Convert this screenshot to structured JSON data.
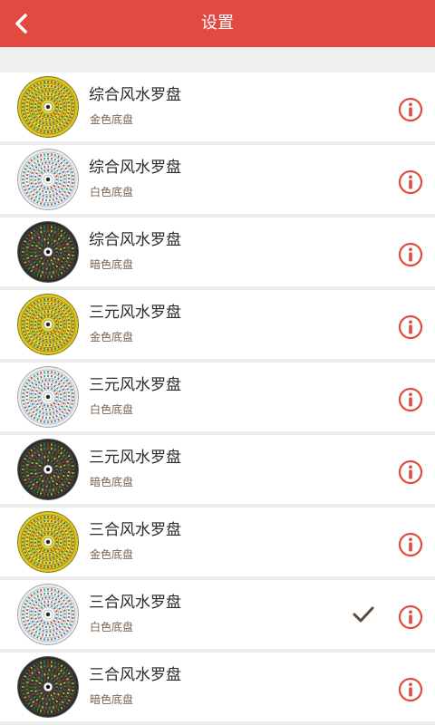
{
  "header": {
    "title": "设置",
    "back_icon": "chevron-left-icon",
    "bg_color": "#e04a40"
  },
  "items": [
    {
      "name": "综合风水罗盘",
      "sub": "金色底盘",
      "theme": "gold",
      "selected": false
    },
    {
      "name": "综合风水罗盘",
      "sub": "白色底盘",
      "theme": "white",
      "selected": false
    },
    {
      "name": "综合风水罗盘",
      "sub": "暗色底盘",
      "theme": "dark",
      "selected": false
    },
    {
      "name": "三元风水罗盘",
      "sub": "金色底盘",
      "theme": "gold",
      "selected": false
    },
    {
      "name": "三元风水罗盘",
      "sub": "白色底盘",
      "theme": "white",
      "selected": false
    },
    {
      "name": "三元风水罗盘",
      "sub": "暗色底盘",
      "theme": "dark",
      "selected": false
    },
    {
      "name": "三合风水罗盘",
      "sub": "金色底盘",
      "theme": "gold",
      "selected": false
    },
    {
      "name": "三合风水罗盘",
      "sub": "白色底盘",
      "theme": "white",
      "selected": true
    },
    {
      "name": "三合风水罗盘",
      "sub": "暗色底盘",
      "theme": "dark",
      "selected": false
    }
  ],
  "icons": {
    "info": "info-circle-icon",
    "check": "checkmark-icon"
  },
  "colors": {
    "accent": "#e04a40",
    "check": "#5b4a3e"
  }
}
